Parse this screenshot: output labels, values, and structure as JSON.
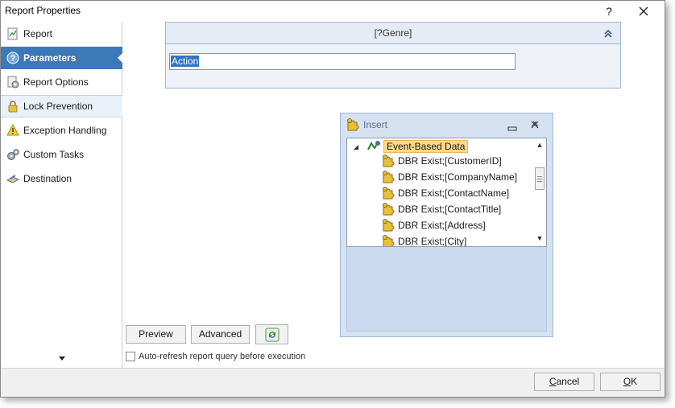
{
  "window": {
    "title": "Report Properties",
    "help_label": "?"
  },
  "sidebar": {
    "items": [
      {
        "label": "Report",
        "icon": "report-icon"
      },
      {
        "label": "Parameters",
        "icon": "help-circle-icon"
      },
      {
        "label": "Report Options",
        "icon": "report-options-icon"
      },
      {
        "label": "Lock Prevention",
        "icon": "lock-icon"
      },
      {
        "label": "Exception Handling",
        "icon": "warning-icon"
      },
      {
        "label": "Custom Tasks",
        "icon": "gears-icon"
      },
      {
        "label": "Destination",
        "icon": "destination-icon"
      }
    ],
    "active_index": 1,
    "hover_index": 3
  },
  "parameter": {
    "header": "[?Genre]",
    "value": "Action"
  },
  "insert": {
    "title": "Insert",
    "root_label": "Event-Based Data",
    "items": [
      "DBR Exist;[CustomerID]",
      "DBR Exist;[CompanyName]",
      "DBR Exist;[ContactName]",
      "DBR Exist;[ContactTitle]",
      "DBR Exist;[Address]",
      "DBR Exist;[City]"
    ]
  },
  "buttons": {
    "preview": "Preview",
    "advanced": "Advanced",
    "cancel_pre": "",
    "cancel_u": "C",
    "cancel_post": "ancel",
    "ok_u": "O",
    "ok_post": "K"
  },
  "options": {
    "auto_refresh_label": "Auto-refresh report query before execution",
    "auto_refresh_checked": false
  },
  "colors": {
    "active_nav": "#3d78b9",
    "selection": "#3373c4",
    "panel_border": "#9fb8d6"
  }
}
